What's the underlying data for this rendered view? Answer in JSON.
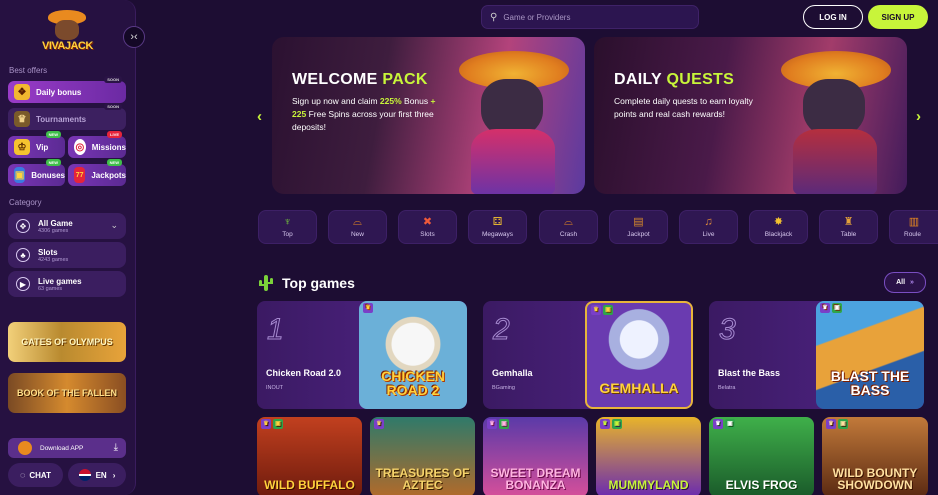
{
  "logo_text": "VIVAJACK",
  "header": {
    "search_placeholder": "Game or Providers",
    "login_label": "LOG IN",
    "signup_label": "SIGN UP"
  },
  "sidebar": {
    "best_offers_label": "Best offers",
    "offers": [
      {
        "label": "Daily bonus",
        "badge": "SOON",
        "icon": "gift-icon"
      },
      {
        "label": "Tournaments",
        "badge": "SOON",
        "icon": "trophy-icon"
      },
      {
        "label": "Vip",
        "badge": "NEW",
        "icon": "crown-icon"
      },
      {
        "label": "Missions",
        "badge": "LIVE",
        "icon": "target-icon"
      },
      {
        "label": "Bonuses",
        "badge": "NEW",
        "icon": "gift-box-icon"
      },
      {
        "label": "Jackpots",
        "badge": "NEW",
        "icon": "slot-777-icon"
      }
    ],
    "category_label": "Category",
    "categories": [
      {
        "label": "All Game",
        "count": "4306 games"
      },
      {
        "label": "Slots",
        "count": "4243 games"
      },
      {
        "label": "Live games",
        "count": "63 games"
      }
    ],
    "promos": [
      {
        "label": "GATES OF OLYMPUS"
      },
      {
        "label": "BOOK OF THE FALLEN"
      }
    ],
    "download_label": "Download APP",
    "chat_label": "CHAT",
    "language_label": "EN"
  },
  "banners": [
    {
      "title_a": "WELCOME",
      "title_b": "PACK",
      "desc_a": "Sign up now and claim",
      "desc_hl1": "225%",
      "desc_b": "Bonus",
      "desc_hl2": "+ 225",
      "desc_c": "Free Spins across your first three deposits!"
    },
    {
      "title_a": "DAILY",
      "title_b": "QUESTS",
      "desc": "Complete daily quests to earn loyalty points and real cash rewards!"
    }
  ],
  "categories_bar": [
    "Top",
    "New",
    "Slots",
    "Megaways",
    "Crash",
    "Jackpot",
    "Live",
    "Blackjack",
    "Table",
    "Roule"
  ],
  "top_games": {
    "title": "Top games",
    "all_label": "All",
    "ranked": [
      {
        "rank": "1",
        "name": "Chicken Road 2.0",
        "provider": "INOUT",
        "thumb_text": "CHICKEN ROAD 2"
      },
      {
        "rank": "2",
        "name": "Gemhalla",
        "provider": "BGaming",
        "thumb_text": "GEMHALLA"
      },
      {
        "rank": "3",
        "name": "Blast the Bass",
        "provider": "Belatra",
        "thumb_text": "BLAST THE BASS"
      }
    ],
    "grid": [
      "WILD BUFFALO",
      "TREASURES OF AZTEC",
      "SWEET DREAM BONANZA",
      "MUMMYLAND",
      "ELVIS FROG",
      "WILD BOUNTY SHOWDOWN"
    ]
  }
}
